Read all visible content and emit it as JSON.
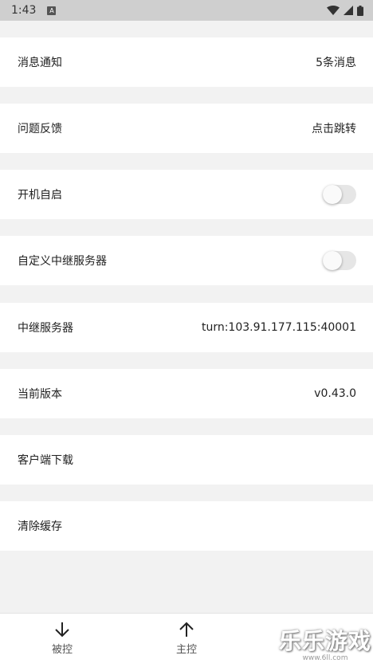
{
  "status_bar": {
    "time": "1:43",
    "notif_badge": "A"
  },
  "settings": {
    "notifications": {
      "label": "消息通知",
      "value": "5条消息"
    },
    "feedback": {
      "label": "问题反馈",
      "value": "点击跳转"
    },
    "auto_start": {
      "label": "开机自启",
      "enabled": false
    },
    "custom_relay": {
      "label": "自定义中继服务器",
      "enabled": false
    },
    "relay_server": {
      "label": "中继服务器",
      "value": "turn:103.91.177.115:40001"
    },
    "version": {
      "label": "当前版本",
      "value": "v0.43.0"
    },
    "client_download": {
      "label": "客户端下载"
    },
    "clear_cache": {
      "label": "清除缓存"
    }
  },
  "bottom_nav": {
    "controlled": {
      "label": "被控",
      "icon": "arrow-down-icon"
    },
    "controller": {
      "label": "主控",
      "icon": "arrow-up-icon"
    }
  },
  "watermark": {
    "text": "乐乐游戏",
    "url": "www.6ll.com"
  }
}
